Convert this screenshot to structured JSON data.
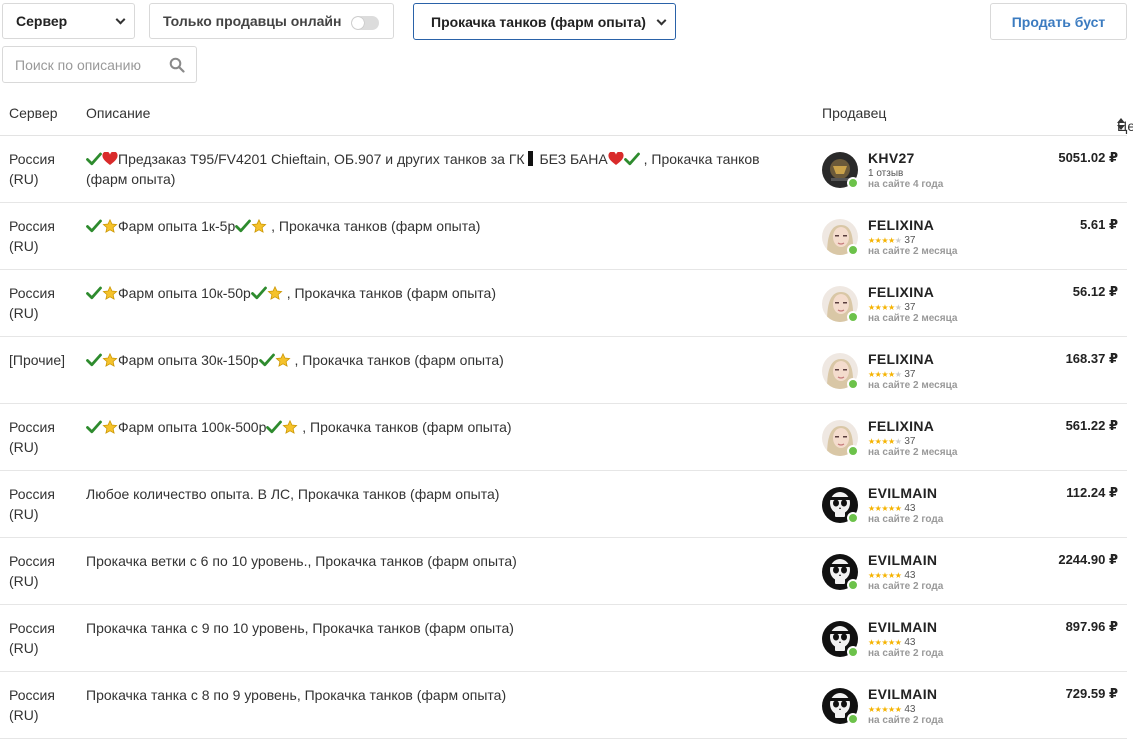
{
  "filters": {
    "server_select": "Сервер",
    "online_toggle_label": "Только продавцы онлайн",
    "category_select": "Прокачка танков (фарм опыта)",
    "sell_button": "Продать буст",
    "search_placeholder": "Поиск по описанию"
  },
  "table": {
    "headers": {
      "server": "Сервер",
      "description": "Описание",
      "seller": "Продавец",
      "price": "Цена"
    },
    "rows": [
      {
        "server": "Россия (RU)",
        "description": [
          {
            "t": "icon",
            "v": "check-icon"
          },
          {
            "t": "icon",
            "v": "heart-icon"
          },
          {
            "t": "text",
            "v": "Предзаказ T95/FV4201 Chieftain, ОБ.907 и других танков за ГК"
          },
          {
            "t": "icon",
            "v": "black-bar-icon"
          },
          {
            "t": "text",
            "v": " БЕЗ БАНА"
          },
          {
            "t": "icon",
            "v": "heart-icon"
          },
          {
            "t": "icon",
            "v": "check-icon"
          },
          {
            "t": "text",
            "v": " , Прокачка танков (фарм опыта)"
          }
        ],
        "seller": {
          "name": "KHV27",
          "reviews_text": "1 отзыв",
          "rating": null,
          "since": "на сайте 4 года",
          "avatar": "avatar-tank-icon",
          "online": true
        },
        "price": "5051.02 ₽"
      },
      {
        "server": "Россия (RU)",
        "description": [
          {
            "t": "icon",
            "v": "check-icon"
          },
          {
            "t": "icon",
            "v": "star-icon"
          },
          {
            "t": "text",
            "v": "Фарм опыта 1к-5р"
          },
          {
            "t": "icon",
            "v": "check-icon"
          },
          {
            "t": "icon",
            "v": "star-icon"
          },
          {
            "t": "text",
            "v": " , Прокачка танков (фарм опыта)"
          }
        ],
        "seller": {
          "name": "FELIXINA",
          "reviews_text": "37",
          "rating": 4,
          "since": "на сайте 2 месяца",
          "avatar": "avatar-girl-icon",
          "online": true
        },
        "price": "5.61 ₽"
      },
      {
        "server": "Россия (RU)",
        "description": [
          {
            "t": "icon",
            "v": "check-icon"
          },
          {
            "t": "icon",
            "v": "star-icon"
          },
          {
            "t": "text",
            "v": "Фарм опыта 10к-50р"
          },
          {
            "t": "icon",
            "v": "check-icon"
          },
          {
            "t": "icon",
            "v": "star-icon"
          },
          {
            "t": "text",
            "v": " , Прокачка танков (фарм опыта)"
          }
        ],
        "seller": {
          "name": "FELIXINA",
          "reviews_text": "37",
          "rating": 4,
          "since": "на сайте 2 месяца",
          "avatar": "avatar-girl-icon",
          "online": true
        },
        "price": "56.12 ₽"
      },
      {
        "server": "[Прочие]",
        "description": [
          {
            "t": "icon",
            "v": "check-icon"
          },
          {
            "t": "icon",
            "v": "star-icon"
          },
          {
            "t": "text",
            "v": "Фарм опыта 30к-150р"
          },
          {
            "t": "icon",
            "v": "check-icon"
          },
          {
            "t": "icon",
            "v": "star-icon"
          },
          {
            "t": "text",
            "v": " , Прокачка танков (фарм опыта)"
          }
        ],
        "seller": {
          "name": "FELIXINA",
          "reviews_text": "37",
          "rating": 4,
          "since": "на сайте 2 месяца",
          "avatar": "avatar-girl-icon",
          "online": true
        },
        "price": "168.37 ₽"
      },
      {
        "server": "Россия (RU)",
        "description": [
          {
            "t": "icon",
            "v": "check-icon"
          },
          {
            "t": "icon",
            "v": "star-icon"
          },
          {
            "t": "text",
            "v": "Фарм опыта 100к-500р"
          },
          {
            "t": "icon",
            "v": "check-icon"
          },
          {
            "t": "icon",
            "v": "star-icon"
          },
          {
            "t": "text",
            "v": " , Прокачка танков (фарм опыта)"
          }
        ],
        "seller": {
          "name": "FELIXINA",
          "reviews_text": "37",
          "rating": 4,
          "since": "на сайте 2 месяца",
          "avatar": "avatar-girl-icon",
          "online": true
        },
        "price": "561.22 ₽"
      },
      {
        "server": "Россия (RU)",
        "description": [
          {
            "t": "text",
            "v": "Любое количество опыта. В ЛС, Прокачка танков (фарм опыта)"
          }
        ],
        "seller": {
          "name": "EVILMAIN",
          "reviews_text": "43",
          "rating": 5,
          "since": "на сайте 2 года",
          "avatar": "avatar-skull-icon",
          "online": true
        },
        "price": "112.24 ₽"
      },
      {
        "server": "Россия (RU)",
        "description": [
          {
            "t": "text",
            "v": "Прокачка ветки с 6 по 10 уровень., Прокачка танков (фарм опыта)"
          }
        ],
        "seller": {
          "name": "EVILMAIN",
          "reviews_text": "43",
          "rating": 5,
          "since": "на сайте 2 года",
          "avatar": "avatar-skull-icon",
          "online": true
        },
        "price": "2244.90 ₽"
      },
      {
        "server": "Россия (RU)",
        "description": [
          {
            "t": "text",
            "v": "Прокачка танка с 9 по 10 уровень, Прокачка танков (фарм опыта)"
          }
        ],
        "seller": {
          "name": "EVILMAIN",
          "reviews_text": "43",
          "rating": 5,
          "since": "на сайте 2 года",
          "avatar": "avatar-skull-icon",
          "online": true
        },
        "price": "897.96 ₽"
      },
      {
        "server": "Россия (RU)",
        "description": [
          {
            "t": "text",
            "v": "Прокачка танка с 8 по 9 уровень, Прокачка танков (фарм опыта)"
          }
        ],
        "seller": {
          "name": "EVILMAIN",
          "reviews_text": "43",
          "rating": 5,
          "since": "на сайте 2 года",
          "avatar": "avatar-skull-icon",
          "online": true
        },
        "price": "729.59 ₽"
      }
    ]
  },
  "colors": {
    "accent": "#3b7bc0",
    "online": "#6cc24a",
    "star": "#f5b301",
    "check": "#2e8b2e",
    "heart": "#d92b2b"
  }
}
